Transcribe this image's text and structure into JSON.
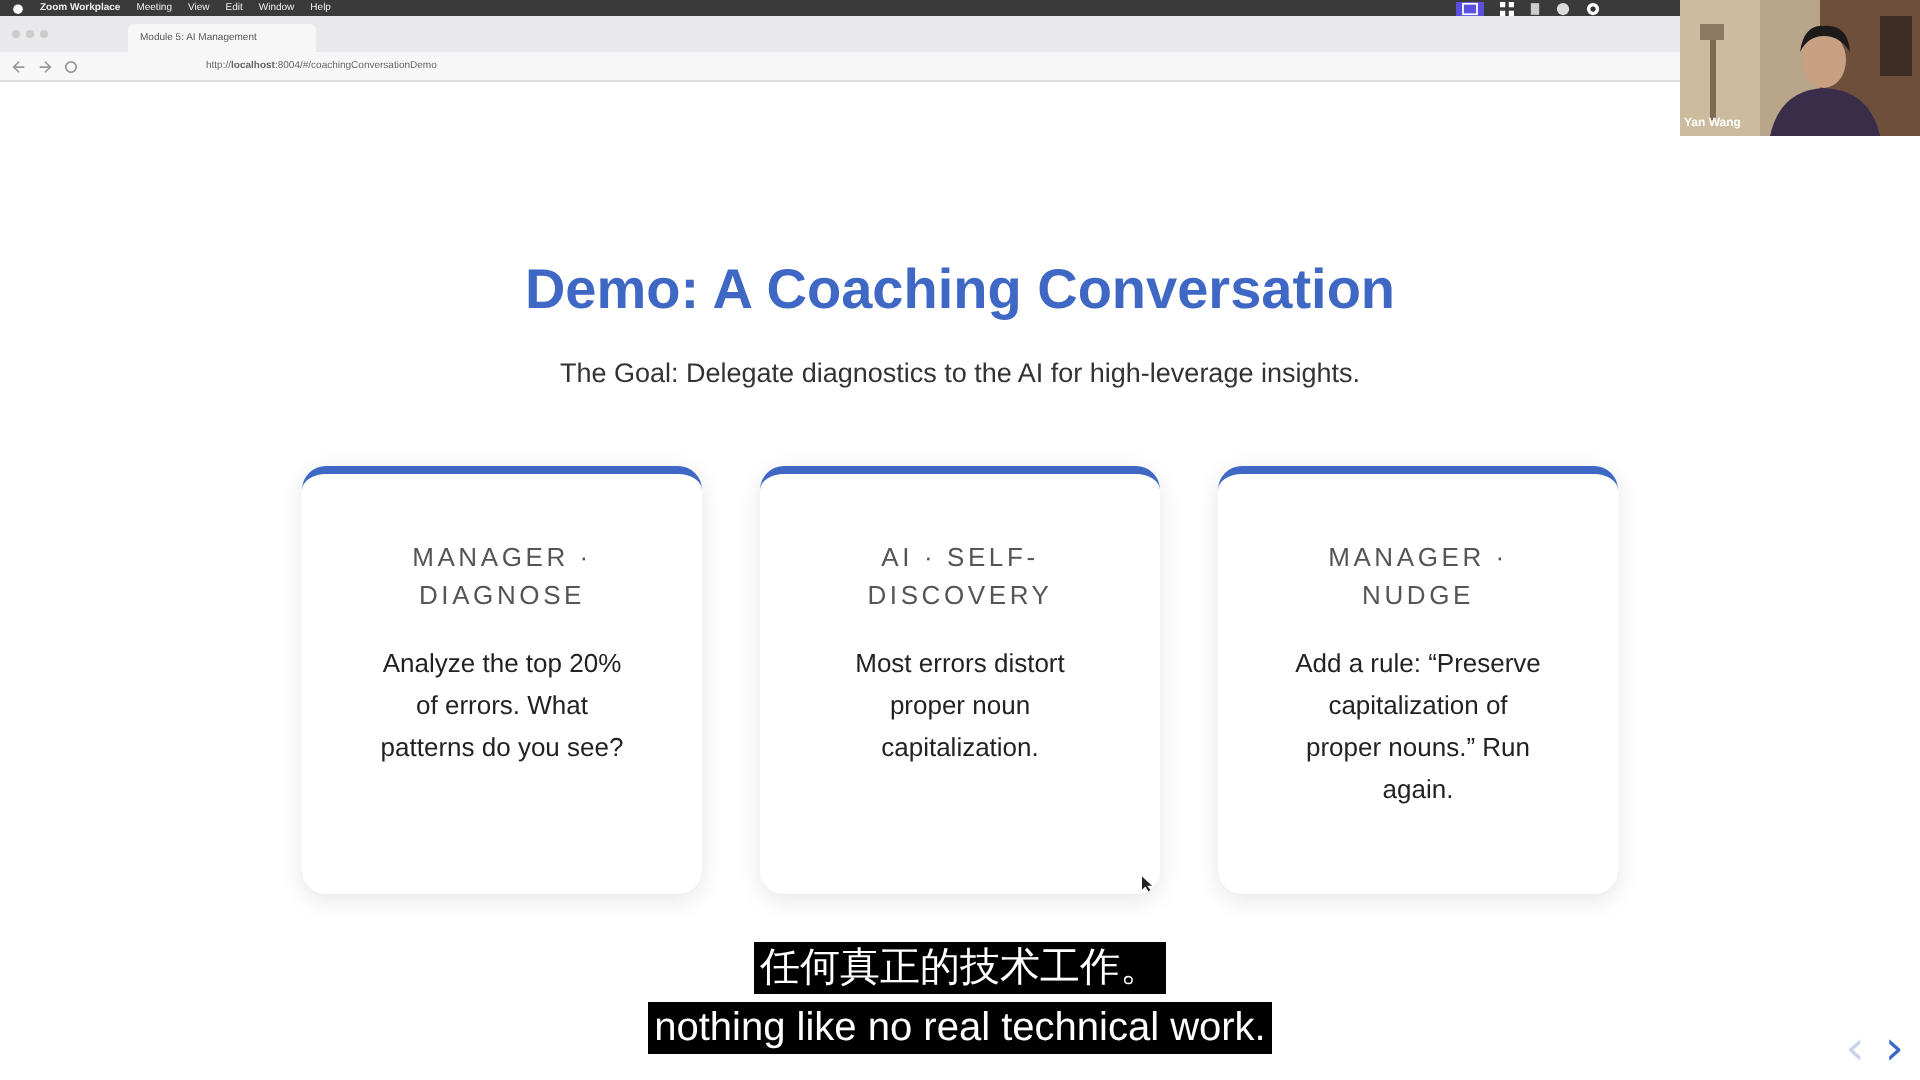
{
  "menu_bar": {
    "items": [
      "Zoom Workplace",
      "Meeting",
      "View",
      "Edit",
      "Window",
      "Help"
    ]
  },
  "browser": {
    "tab": {
      "title": "Module 5: AI Management"
    },
    "url": "http://**localhost**:8004/#/coachingConversationDemo"
  },
  "video_thumbnail": {
    "name": "Yan Wang"
  },
  "slide": {
    "title": "Demo: A Coaching Conversation",
    "subtitle": "The Goal: Delegate diagnostics to the AI for high-leverage insights.",
    "cards": [
      {
        "heading": "MANAGER · DIAGNOSE",
        "body": "Analyze the top 20% of errors. What patterns do you see?"
      },
      {
        "heading": "AI · SELF-DISCOVERY",
        "body": "Most errors distort proper noun capitalization."
      },
      {
        "heading": "MANAGER · NUDGE",
        "body": "Add a rule: “Preserve capitalization of proper nouns.” Run again."
      }
    ]
  },
  "captions": [
    "任何真正的技术工作。",
    "nothing like no real technical work."
  ],
  "nav": [
    {
      "label": "‹",
      "disabled": true
    },
    {
      "label": "›",
      "disabled": false
    }
  ]
}
